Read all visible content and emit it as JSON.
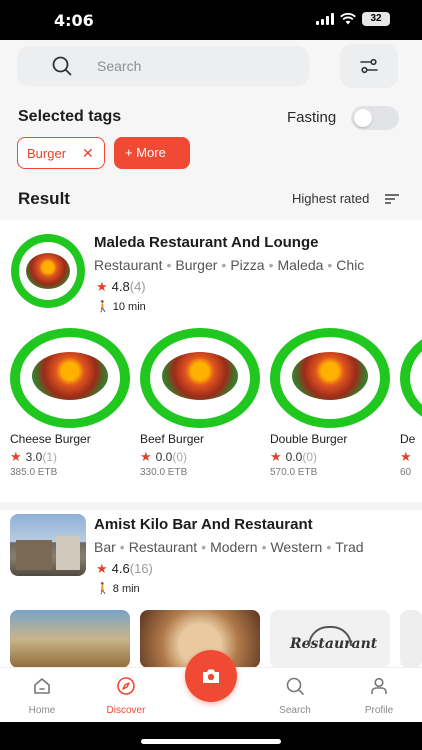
{
  "status_bar": {
    "time": "4:06",
    "battery": "32"
  },
  "search": {
    "placeholder": "Search"
  },
  "tags": {
    "title": "Selected tags",
    "fasting_label": "Fasting",
    "fasting_on": false,
    "selected": [
      "Burger"
    ],
    "more_label": "+ More",
    "remove_symbol": "✕"
  },
  "results": {
    "title": "Result",
    "sort_label": "Highest rated"
  },
  "restaurants": [
    {
      "name": "Maleda Restaurant And Lounge",
      "tags": [
        "Restaurant",
        "Burger",
        "Pizza",
        "Maleda",
        "Chic"
      ],
      "rating": "4.8",
      "rating_count": "(4)",
      "time": "10 min",
      "items": [
        {
          "name": "Cheese Burger",
          "rating": "3.0",
          "count": "(1)",
          "price": "385.0 ETB"
        },
        {
          "name": "Beef Burger",
          "rating": "0.0",
          "count": "(0)",
          "price": "330.0 ETB"
        },
        {
          "name": "Double Burger",
          "rating": "0.0",
          "count": "(0)",
          "price": "570.0 ETB"
        },
        {
          "name": "De",
          "rating": "",
          "count": "",
          "price": "60"
        }
      ]
    },
    {
      "name": "Amist Kilo Bar And Restaurant",
      "tags": [
        "Bar",
        "Restaurant",
        "Modern",
        "Western",
        "Trad"
      ],
      "rating": "4.6",
      "rating_count": "(16)",
      "time": "8 min",
      "thumb_text": "Restaurant"
    }
  ],
  "nav": {
    "home": "Home",
    "discover": "Discover",
    "search": "Search",
    "profile": "Profile"
  },
  "colors": {
    "accent": "#F04A34",
    "logo_green": "#1FC71F"
  }
}
